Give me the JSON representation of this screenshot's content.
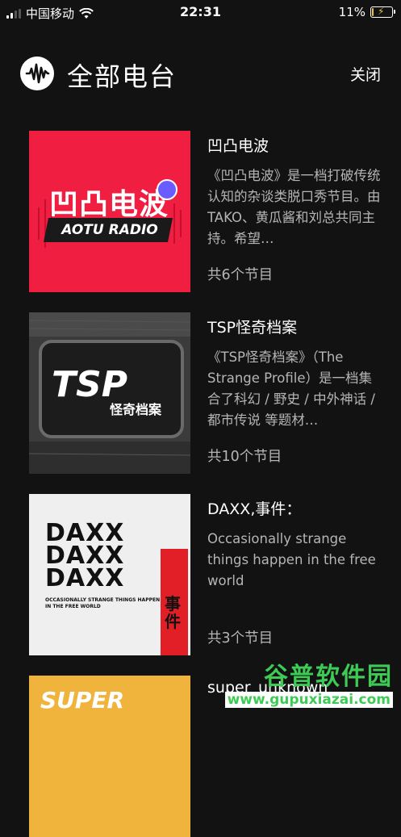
{
  "status_bar": {
    "carrier": "中国移动",
    "time": "22:31",
    "battery": "11%",
    "battery_level": 0.11
  },
  "header": {
    "title": "全部电台",
    "close_label": "关闭"
  },
  "stations": [
    {
      "name": "凹凸电波",
      "description": "《凹凸电波》是一档打破传统认知的杂谈类脱口秀节目。由TAKO、黄瓜酱和刘总共同主持。希望…",
      "count": "共6个节目",
      "cover_title": "凹凸电波",
      "cover_subtitle": "AOTU RADIO"
    },
    {
      "name": "TSP怪奇档案",
      "description": "《TSP怪奇档案》（The Strange Profile）是一档集合了科幻 / 野史 / 中外神话 / 都市传说 等题材…",
      "count": "共10个节目",
      "cover_title": "TSP",
      "cover_subtitle": "怪奇档案"
    },
    {
      "name": "DAXX,事件：",
      "description": "Occasionally strange things happen in the free world",
      "count": "共3个节目",
      "cover_title": "DAXX",
      "cover_tagline": "OCCASIONALLY STRANGE THINGS HAPPEN IN THE FREE WORLD",
      "cover_side": "事件"
    },
    {
      "name": "super_unknown",
      "cover_title": "SUPER"
    }
  ],
  "watermark": {
    "title": "谷普软件园",
    "url": "www.gupuxiazai.com"
  }
}
